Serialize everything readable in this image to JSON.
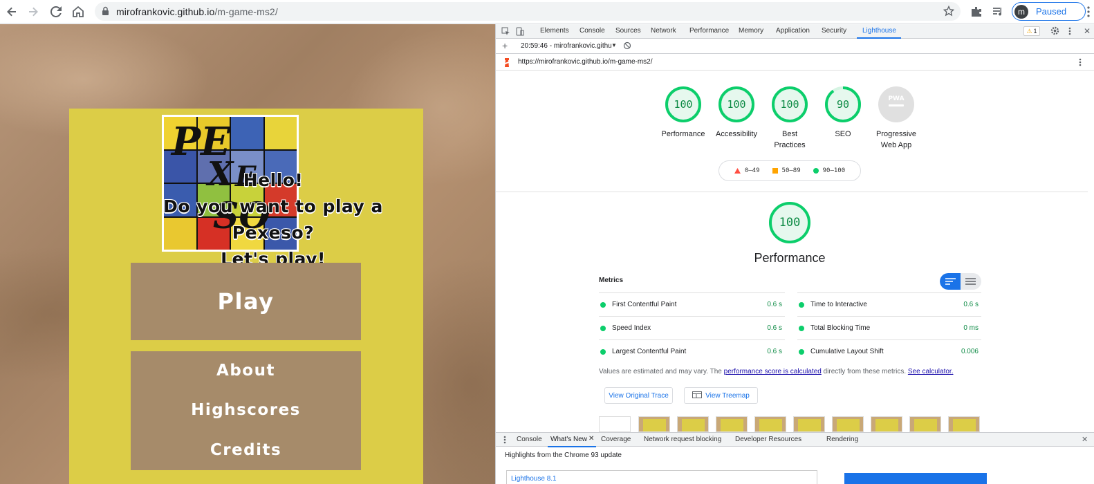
{
  "browser": {
    "url_host": "mirofrankovic.github.io",
    "url_path": "/m-game-ms2/",
    "profile_initial": "m",
    "profile_status": "Paused"
  },
  "game": {
    "logo_letters": [
      "PE",
      "X",
      "E",
      "SO"
    ],
    "greeting_lines": [
      "Hello!",
      "Do you want to play a",
      "Pexeso?",
      "Let's play!"
    ],
    "play_label": "Play",
    "menu": [
      "About",
      "Highscores",
      "Credits"
    ]
  },
  "devtools": {
    "tabs": [
      "Elements",
      "Console",
      "Sources",
      "Network",
      "Performance",
      "Memory",
      "Application",
      "Security",
      "Lighthouse"
    ],
    "active_tab": "Lighthouse",
    "warning_count": "1",
    "report_selector": "20:59:46 - mirofrankovic.githu",
    "report_url": "https://mirofrankovic.github.io/m-game-ms2/",
    "gauges": [
      {
        "score": "100",
        "label": "Performance",
        "value": 100
      },
      {
        "score": "100",
        "label": "Accessibility",
        "value": 100
      },
      {
        "score": "100",
        "label": "Best Practices",
        "value": 100
      },
      {
        "score": "90",
        "label": "SEO",
        "value": 90
      },
      {
        "score": "PWA",
        "label": "Progressive Web App",
        "value": 0
      }
    ],
    "legend": [
      "0–49",
      "50–89",
      "90–100"
    ],
    "section": {
      "score": "100",
      "title": "Performance",
      "metrics_label": "Metrics",
      "metrics": [
        {
          "name": "First Contentful Paint",
          "value": "0.6 s"
        },
        {
          "name": "Time to Interactive",
          "value": "0.6 s"
        },
        {
          "name": "Speed Index",
          "value": "0.6 s"
        },
        {
          "name": "Total Blocking Time",
          "value": "0 ms"
        },
        {
          "name": "Largest Contentful Paint",
          "value": "0.6 s"
        },
        {
          "name": "Cumulative Layout Shift",
          "value": "0.006"
        }
      ],
      "note_prefix": "Values are estimated and may vary. The ",
      "note_link1": "performance score is calculated",
      "note_middle": " directly from these metrics. ",
      "note_link2": "See calculator.",
      "btn_trace": "View Original Trace",
      "btn_treemap": "View Treemap"
    },
    "drawer_tabs": [
      "Console",
      "What's New",
      "Coverage",
      "Network request blocking",
      "Developer Resources",
      "Rendering"
    ],
    "drawer_active": "What's New",
    "highlights": "Highlights from the Chrome 93 update",
    "card_title": "Lighthouse 8.1"
  },
  "colors": {
    "pass_green": "#0cce6b",
    "panel_yellow": "#dccd47",
    "button_brown": "#a68b6a",
    "accent_blue": "#1a73e8"
  }
}
